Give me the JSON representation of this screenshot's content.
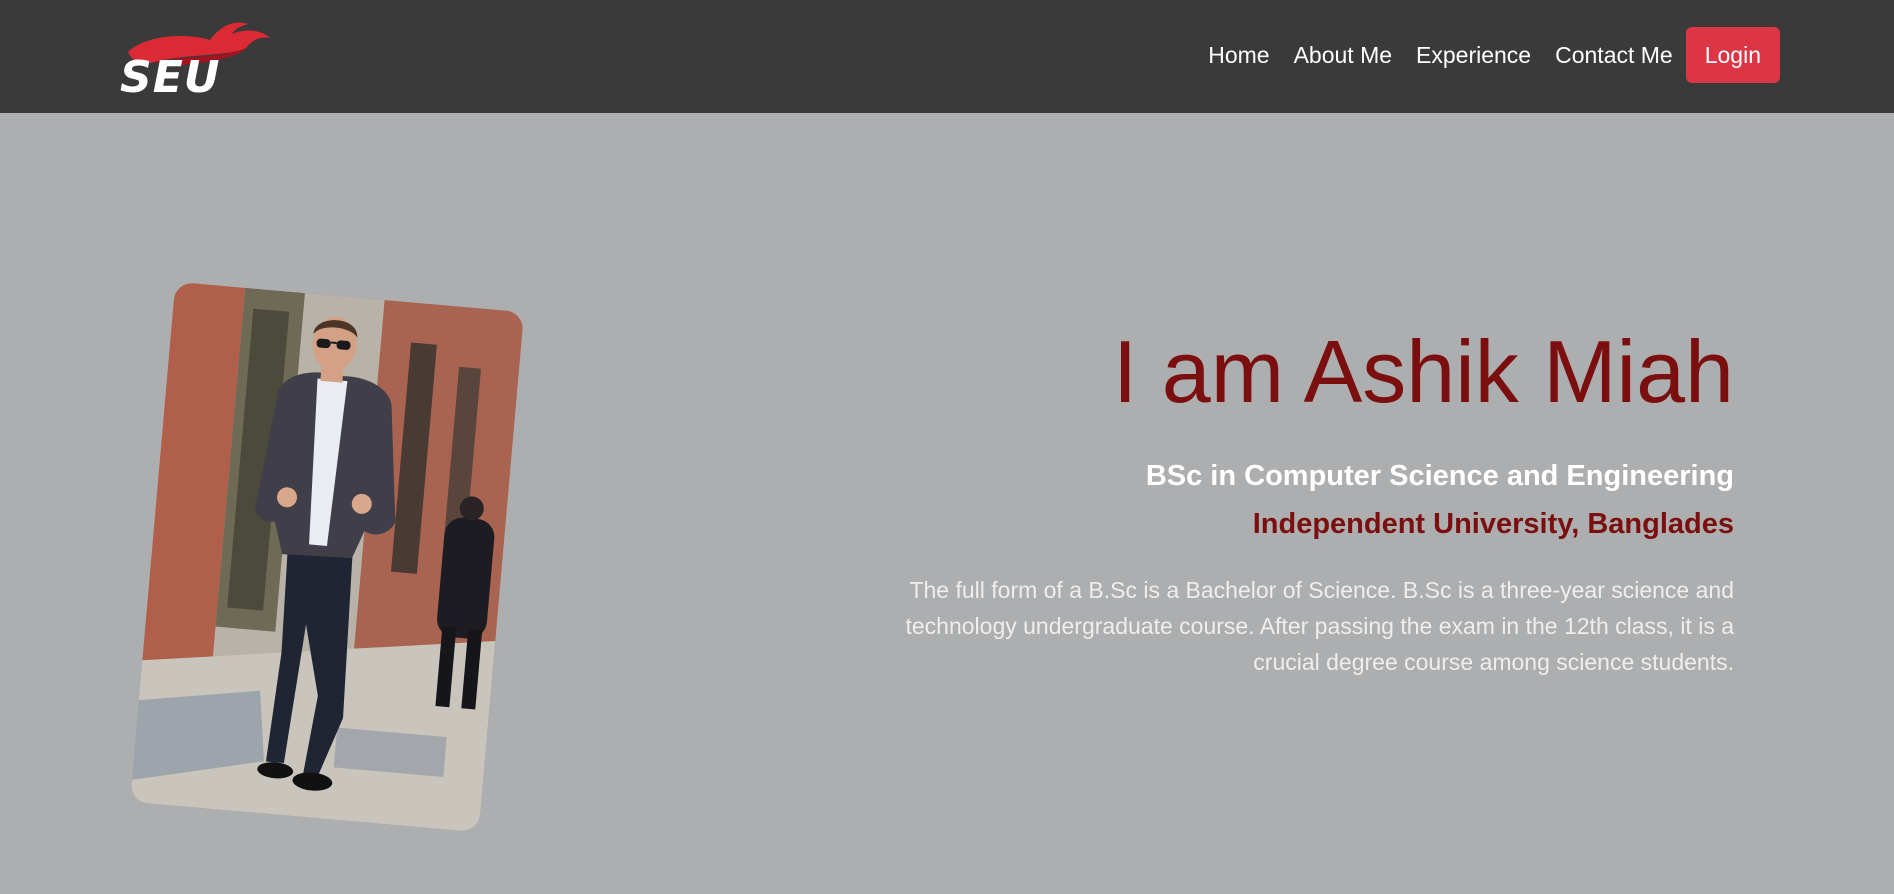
{
  "brand": {
    "logo_text": "SEU",
    "logo_flame_color": "#dc2a35"
  },
  "nav": {
    "items": [
      {
        "label": "Home"
      },
      {
        "label": "About Me"
      },
      {
        "label": "Experience"
      },
      {
        "label": "Contact Me"
      }
    ],
    "login_label": "Login"
  },
  "hero": {
    "title": "I am Ashik Miah",
    "degree": "BSc in Computer Science and Engineering",
    "university": "Independent University, Banglades",
    "description": "The full form of a B.Sc is a Bachelor of Science. B.Sc is a three-year science and technology undergraduate course. After passing the exam in the 12th class, it is a crucial degree course among science students."
  },
  "colors": {
    "navbar_bg": "#3a3a3b",
    "page_bg": "#adaeaf",
    "accent_dark_red": "#7b0f0f",
    "button_red": "#dc3545"
  }
}
